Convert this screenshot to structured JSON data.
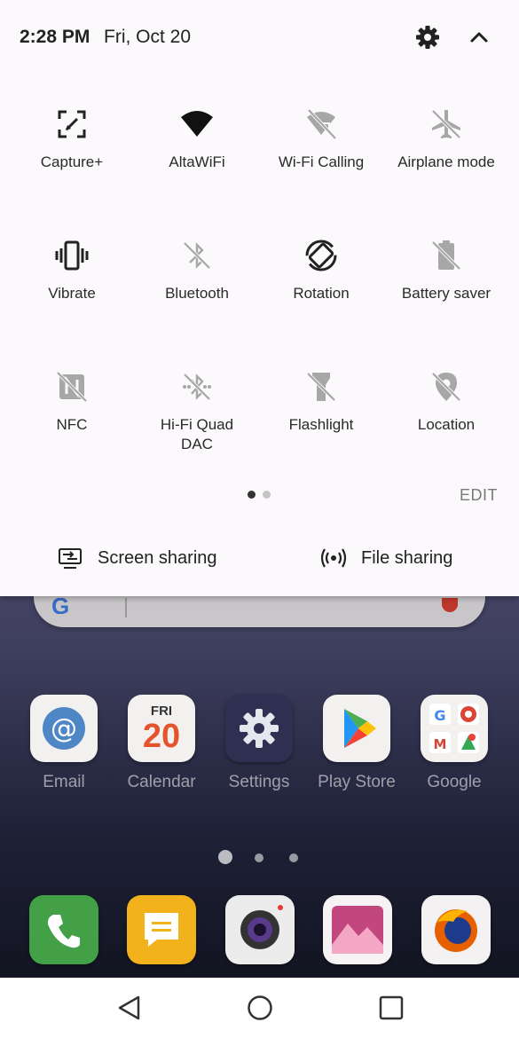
{
  "status_bar": {
    "time": "2:28 PM",
    "date": "Fri, Oct 20",
    "settings_icon": "gear-icon",
    "collapse_icon": "chevron-up-icon"
  },
  "quick_settings": {
    "tiles": [
      {
        "label": "Capture+",
        "icon": "capture-plus-icon",
        "active": true
      },
      {
        "label": "AltaWiFi",
        "icon": "wifi-icon",
        "active": true
      },
      {
        "label": "Wi-Fi Calling",
        "icon": "wifi-calling-off-icon",
        "active": false
      },
      {
        "label": "Airplane mode",
        "icon": "airplane-off-icon",
        "active": false
      },
      {
        "label": "Vibrate",
        "icon": "vibrate-icon",
        "active": true
      },
      {
        "label": "Bluetooth",
        "icon": "bluetooth-off-icon",
        "active": false
      },
      {
        "label": "Rotation",
        "icon": "rotation-icon",
        "active": true
      },
      {
        "label": "Battery saver",
        "icon": "battery-saver-off-icon",
        "active": false
      },
      {
        "label": "NFC",
        "icon": "nfc-off-icon",
        "active": false
      },
      {
        "label": "Hi-Fi Quad\nDAC",
        "icon": "hifi-dac-off-icon",
        "active": false
      },
      {
        "label": "Flashlight",
        "icon": "flashlight-off-icon",
        "active": false
      },
      {
        "label": "Location",
        "icon": "location-off-icon",
        "active": false
      }
    ],
    "page_count": 2,
    "current_page": 1,
    "edit_label": "EDIT",
    "screen_sharing_label": "Screen sharing",
    "file_sharing_label": "File sharing"
  },
  "home": {
    "apps": [
      {
        "label": "Email",
        "icon": "email-icon"
      },
      {
        "label": "Calendar",
        "icon": "calendar-icon",
        "day_name": "FRI",
        "day_number": "20"
      },
      {
        "label": "Settings",
        "icon": "settings-app-icon"
      },
      {
        "label": "Play Store",
        "icon": "play-store-icon"
      },
      {
        "label": "Google",
        "icon": "google-folder-icon"
      }
    ],
    "dock": [
      {
        "icon": "phone-icon"
      },
      {
        "icon": "messages-icon"
      },
      {
        "icon": "camera-icon"
      },
      {
        "icon": "gallery-icon"
      },
      {
        "icon": "firefox-icon"
      }
    ],
    "page_count": 3,
    "current_page": 1
  },
  "colors": {
    "panel_bg": "#fbf9fb",
    "icon_active": "#222222",
    "icon_inactive": "#9a9a9a",
    "pager_active": "#333333",
    "pager_inactive": "#c4c4c4"
  }
}
